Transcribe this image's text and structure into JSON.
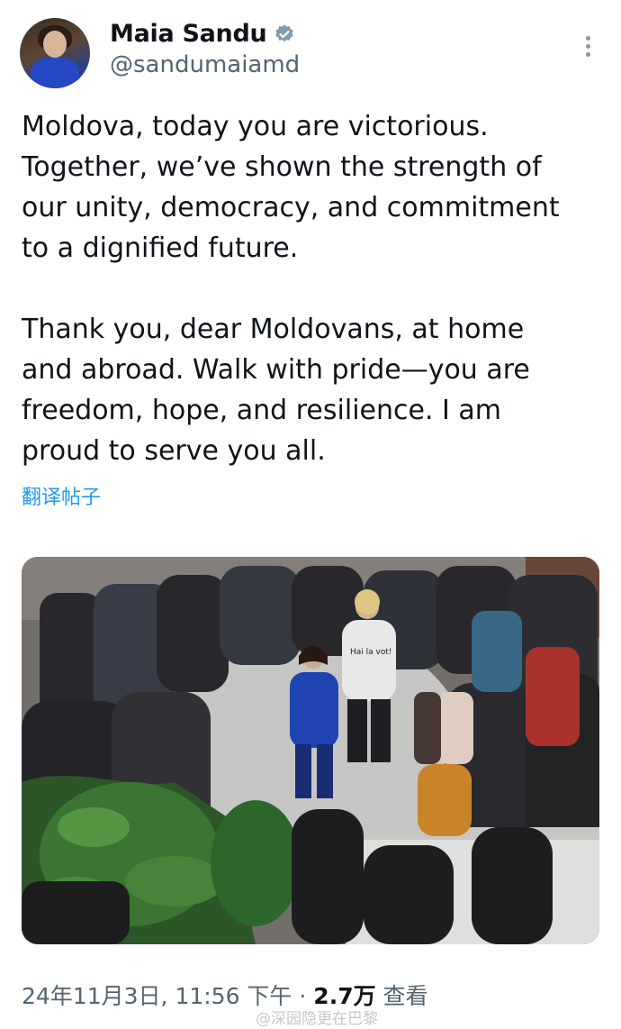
{
  "author": {
    "display_name": "Maia Sandu",
    "handle": "@sandumaiamd",
    "verified": true
  },
  "tweet": {
    "paragraphs": [
      "Moldova, today you are victorious.\nTogether, we’ve shown the strength of\nour unity, democracy, and commitment\nto a dignified future.",
      "Thank you, dear Moldovans, at home\nand abroad. Walk with pride—you are\nfreedom, hope, and resilience. I am\nproud to serve you all."
    ],
    "translate_label": "翻译帖子"
  },
  "photo": {
    "shirt_text": "Hai la vot!"
  },
  "meta": {
    "date": "24年11月3日",
    "time": "11:56 下午",
    "separator": "·",
    "views_count": "2.7万",
    "views_label": "查看"
  },
  "watermark": "@深园隐更在巴黎",
  "colors": {
    "accent": "#1d9bf0",
    "secondary_text": "#536471"
  },
  "icons": {
    "verified": "verified-badge-icon",
    "more": "more-vertical-icon"
  }
}
